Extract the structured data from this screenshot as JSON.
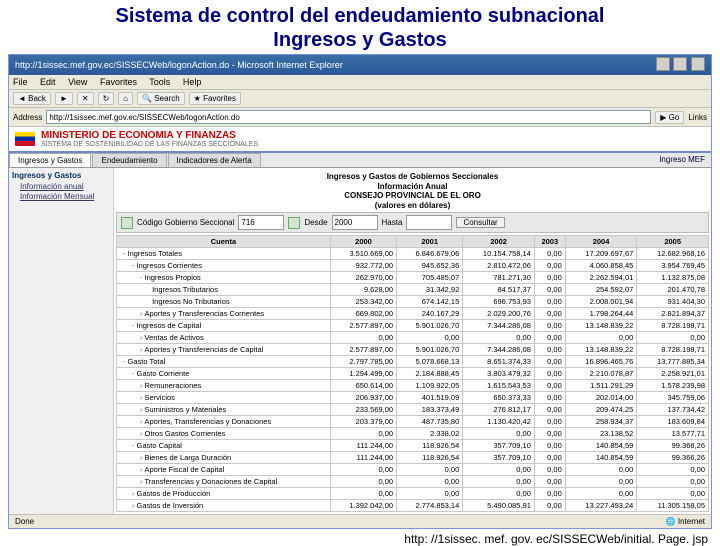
{
  "slide_title_l1": "Sistema de control del endeudamiento subnacional",
  "slide_title_l2": "Ingresos y Gastos",
  "browser": {
    "title": "http://1sissec.mef.gov.ec/SISSECWeb/logonAction.do - Microsoft Internet Explorer",
    "menu": [
      "File",
      "Edit",
      "View",
      "Favorites",
      "Tools",
      "Help"
    ],
    "toolbar": {
      "back": "Back",
      "search": "Search",
      "favorites": "Favorites"
    },
    "addr_label": "Address",
    "addr_value": "http://1sissec.mef.gov.ec/SISSECWeb/logonAction.do",
    "go": "Go",
    "links": "Links",
    "status_done": "Done",
    "status_zone": "Internet"
  },
  "header": {
    "ministry": "MINISTERIO DE ECONOMIA Y FINANZAS",
    "system": "SISTEMA DE SOSTENIBILIDAD DE LAS FINANZAS SECCIONALES"
  },
  "tabs": {
    "t1": "Ingresos y Gastos",
    "t2": "Endeudamiento",
    "t3": "Indicadores de Alerta",
    "right": "Ingreso MEF"
  },
  "sidebar": {
    "hdr": "Ingresos y Gastos",
    "i1": "Información anual",
    "i2": "Información Mensual"
  },
  "report": {
    "l1": "Ingresos y Gastos de Gobiernos Seccionales",
    "l2": "Información Anual",
    "l3": "CONSEJO PROVINCIAL DE EL ORO",
    "l4": "(valores en dólares)"
  },
  "controls": {
    "codigo": "Código Gobierno Seccional",
    "codigo_val": "716",
    "desde": "Desde",
    "desde_val": "2000",
    "hasta": "Hasta",
    "hasta_val": "",
    "consultar": "Consultar"
  },
  "cols": [
    "Cuenta",
    "2000",
    "2001",
    "2002",
    "2003",
    "2004",
    "2005"
  ],
  "rows": [
    {
      "ind": 0,
      "exp": "-",
      "label": "Ingresos Totales",
      "v": [
        "3.510.669,00",
        "6.846.679,06",
        "10.154.758,14",
        "0,00",
        "17.209.697,67",
        "12.682.968,16"
      ]
    },
    {
      "ind": 1,
      "exp": "-",
      "label": "Ingresos Corrientes",
      "v": [
        "932.772,00",
        "945.652,36",
        "2.810.472,06",
        "0,00",
        "4.060.858,45",
        "3.954.769,45"
      ]
    },
    {
      "ind": 2,
      "exp": "-",
      "label": "Ingresos Propios",
      "v": [
        "262.970,00",
        "705.485,07",
        "781.271,30",
        "0,00",
        "2.262.594,01",
        "1.132.875,08"
      ]
    },
    {
      "ind": 3,
      "exp": "",
      "label": "Ingresos Tributarios",
      "v": [
        "9.628,00",
        "31.342,92",
        "84.517,37",
        "0,00",
        "254.592,07",
        "201.470,78"
      ]
    },
    {
      "ind": 3,
      "exp": "",
      "label": "Ingresos No Tributarios",
      "v": [
        "253.342,00",
        "674.142,15",
        "696.753,93",
        "0,00",
        "2.008.001,94",
        "931.404,30"
      ]
    },
    {
      "ind": 2,
      "exp": "›",
      "label": "Aportes y Transferencias Corrientes",
      "v": [
        "669.802,00",
        "240.167,29",
        "2.029.200,76",
        "0,00",
        "1.798.264,44",
        "2.821.894,37"
      ]
    },
    {
      "ind": 1,
      "exp": "-",
      "label": "Ingresos de Capital",
      "v": [
        "2.577.897,00",
        "5.901.026,70",
        "7.344.286,08",
        "0,00",
        "13.148.839,22",
        "8.728.198,71"
      ]
    },
    {
      "ind": 2,
      "exp": "›",
      "label": "Ventas de Activos",
      "v": [
        "0,00",
        "0,00",
        "0,00",
        "0,00",
        "0,00",
        "0,00"
      ]
    },
    {
      "ind": 2,
      "exp": "›",
      "label": "Aportes y Transferencias de Capital",
      "v": [
        "2.577.897,00",
        "5.901.026,70",
        "7.344.286,08",
        "0,00",
        "13.148.839,22",
        "8.728.198,71"
      ]
    },
    {
      "ind": 0,
      "exp": "-",
      "label": "Gasto Total",
      "v": [
        "2.797.785,00",
        "5.078.668,13",
        "8.651.374,33",
        "0,00",
        "16.896.465,76",
        "13.777.885,34"
      ]
    },
    {
      "ind": 1,
      "exp": "-",
      "label": "Gasto Corriente",
      "v": [
        "1.294.499,00",
        "2.184.888,45",
        "3.803.479,32",
        "0,00",
        "2.210.078,87",
        "2.258.921,01"
      ]
    },
    {
      "ind": 2,
      "exp": "›",
      "label": "Remuneraciones",
      "v": [
        "650.614,00",
        "1.109.922,05",
        "1.615.543,53",
        "0,00",
        "1.511.291,29",
        "1.578.239,98"
      ]
    },
    {
      "ind": 2,
      "exp": "›",
      "label": "Servicios",
      "v": [
        "206.937,00",
        "401.519,09",
        "650.373,33",
        "0,00",
        "202.014,00",
        "345.759,06"
      ]
    },
    {
      "ind": 2,
      "exp": "›",
      "label": "Suministros y Materiales",
      "v": [
        "233.569,00",
        "183.373,49",
        "276.812,17",
        "0,00",
        "209.474,25",
        "137.734,42"
      ]
    },
    {
      "ind": 2,
      "exp": "›",
      "label": "Aportes, Transferencias y Donaciones",
      "v": [
        "203.379,00",
        "487.735,80",
        "1.130.420,42",
        "0,00",
        "258.934,37",
        "183.609,84"
      ]
    },
    {
      "ind": 2,
      "exp": "›",
      "label": "Otros Gastos Corrientes",
      "v": [
        "0,00",
        "2.338,02",
        "0,00",
        "0,00",
        "23.138,52",
        "13.577,71"
      ]
    },
    {
      "ind": 1,
      "exp": "-",
      "label": "Gasto Capital",
      "v": [
        "111.244,00",
        "118.926,54",
        "357.709,10",
        "0,00",
        "140.854,59",
        "99.366,26"
      ]
    },
    {
      "ind": 2,
      "exp": "›",
      "label": "Bienes de Larga Duración",
      "v": [
        "111.244,00",
        "118.926,54",
        "357.709,10",
        "0,00",
        "140.854,59",
        "99.366,26"
      ]
    },
    {
      "ind": 2,
      "exp": "›",
      "label": "Aporte Fiscal de Capital",
      "v": [
        "0,00",
        "0,00",
        "0,00",
        "0,00",
        "0,00",
        "0,00"
      ]
    },
    {
      "ind": 2,
      "exp": "›",
      "label": "Transferencias y Donaciones de Capital",
      "v": [
        "0,00",
        "0,00",
        "0,00",
        "0,00",
        "0,00",
        "0,00"
      ]
    },
    {
      "ind": 1,
      "exp": "›",
      "label": "Gastos de Producción",
      "v": [
        "0,00",
        "0,00",
        "0,00",
        "0,00",
        "0,00",
        "0,00"
      ]
    },
    {
      "ind": 1,
      "exp": "›",
      "label": "Gastos de Inversión",
      "v": [
        "1.392.042,00",
        "2.774.853,14",
        "5.490.085,91",
        "0,00",
        "13.227.493,24",
        "11.305.158,05"
      ]
    }
  ],
  "footer_url": "http: //1sissec. mef. gov. ec/SISSECWeb/initial. Page. jsp"
}
